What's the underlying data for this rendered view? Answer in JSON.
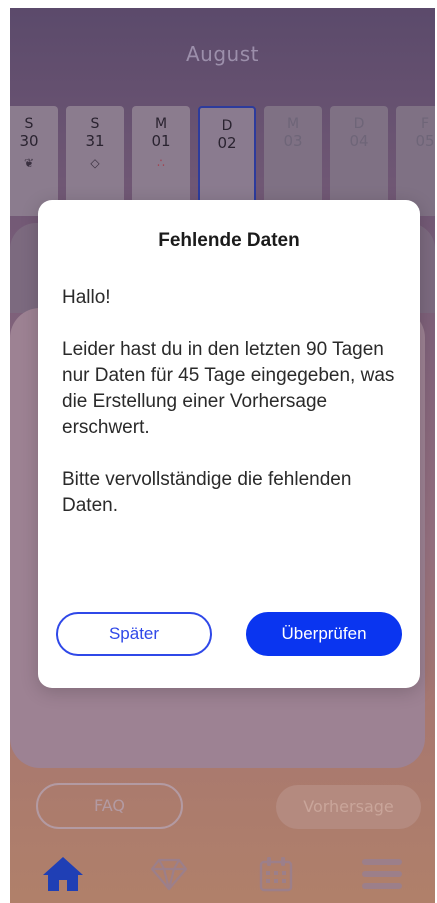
{
  "header": {
    "month": "August"
  },
  "days": [
    {
      "weekday": "S",
      "date": "30",
      "icon": "leaf-icon",
      "icon_glyph": "❦"
    },
    {
      "weekday": "S",
      "date": "31",
      "icon": "gem-icon",
      "icon_glyph": "◇"
    },
    {
      "weekday": "M",
      "date": "01",
      "icon": "drops-icon",
      "icon_glyph": "∴"
    },
    {
      "weekday": "D",
      "date": "02",
      "icon": "",
      "icon_glyph": ""
    },
    {
      "weekday": "M",
      "date": "03",
      "icon": "",
      "icon_glyph": ""
    },
    {
      "weekday": "D",
      "date": "04",
      "icon": "",
      "icon_glyph": ""
    },
    {
      "weekday": "F",
      "date": "05",
      "icon": "",
      "icon_glyph": ""
    }
  ],
  "bottom_buttons": {
    "faq": "FAQ",
    "forecast": "Vorhersage"
  },
  "tabbar": [
    "home-icon",
    "gem-icon",
    "calendar-icon",
    "menu-icon"
  ],
  "dialog": {
    "title": "Fehlende Daten",
    "greeting": "Hallo!",
    "message": "Leider hast du in den letzten 90 Tagen nur Daten für 45 Tage eingegeben, was die Erstellung einer Vorhersage erschwert.",
    "request": "Bitte vervollständige die fehlenden Daten.",
    "later_label": "Später",
    "check_label": "Überprüfen"
  },
  "colors": {
    "primary": "#0a35f0",
    "accent_outline": "#2f48e8",
    "home_tab": "#1f3fb5"
  }
}
